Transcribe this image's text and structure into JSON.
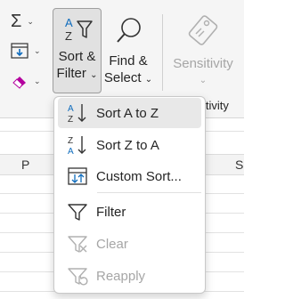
{
  "ribbon": {
    "sort_filter": {
      "line1": "Sort &",
      "line2": "Filter"
    },
    "find_select": {
      "line1": "Find &",
      "line2": "Select"
    },
    "sensitivity": {
      "label": "Sensitivity"
    },
    "group_label": "itivity",
    "autosum_icon": "sigma-icon",
    "fill_icon": "fill-down-icon",
    "clear_icon": "eraser-icon"
  },
  "sheet": {
    "columns": [
      "P",
      "S"
    ]
  },
  "menu": {
    "items": [
      {
        "label": "Sort A to Z",
        "icon": "sort-a-to-z-icon",
        "enabled": true
      },
      {
        "label": "Sort Z to A",
        "icon": "sort-z-to-a-icon",
        "enabled": true
      },
      {
        "label": "Custom Sort...",
        "icon": "custom-sort-icon",
        "enabled": true
      },
      {
        "label": "Filter",
        "icon": "filter-funnel-icon",
        "enabled": true
      },
      {
        "label": "Clear",
        "icon": "clear-filter-icon",
        "enabled": false
      },
      {
        "label": "Reapply",
        "icon": "reapply-filter-icon",
        "enabled": false
      }
    ]
  },
  "colors": {
    "hover": "#e8e8e8",
    "accent": "#0f6cbd",
    "disabled": "#a6a6a6",
    "eraser": "#b4009e"
  }
}
